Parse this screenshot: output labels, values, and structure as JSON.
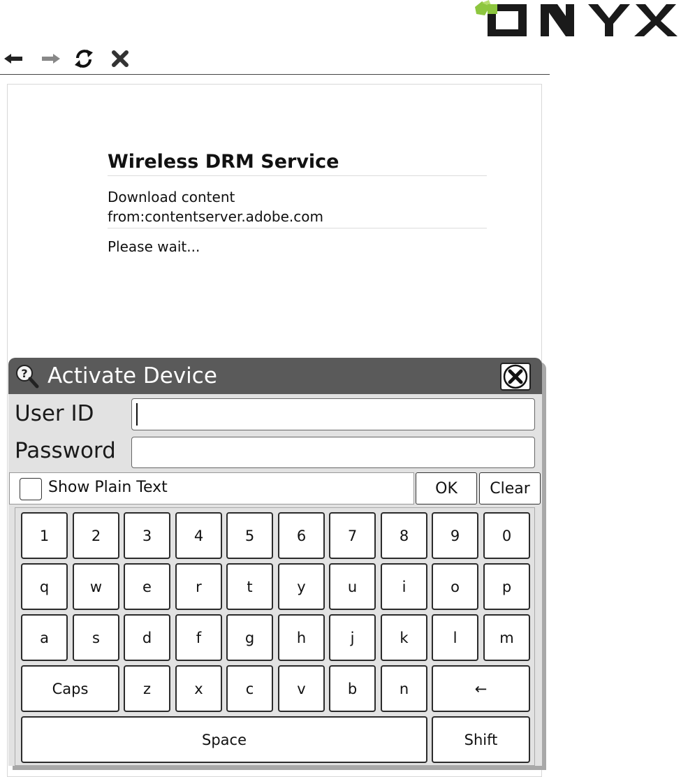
{
  "brand": {
    "logo_text": "ONYX",
    "logo_accent": "#8dc63f"
  },
  "toolbar": [
    {
      "name": "back-arrow-icon"
    },
    {
      "name": "forward-arrow-icon"
    },
    {
      "name": "refresh-icon"
    },
    {
      "name": "stop-icon"
    }
  ],
  "page": {
    "title": "Wireless DRM Service",
    "line1": "Download content",
    "line2": "from:contentserver.adobe.com",
    "status": "Please wait..."
  },
  "dialog": {
    "title": "Activate Device",
    "user_label": "User ID",
    "user_value": "",
    "password_label": "Password",
    "password_value": "",
    "show_plain_label": "Show Plain Text",
    "show_plain_checked": false,
    "ok_label": "OK",
    "clear_label": "Clear"
  },
  "keyboard": {
    "row1": [
      "1",
      "2",
      "3",
      "4",
      "5",
      "6",
      "7",
      "8",
      "9",
      "0"
    ],
    "row2": [
      "q",
      "w",
      "e",
      "r",
      "t",
      "y",
      "u",
      "i",
      "o",
      "p"
    ],
    "row3": [
      "a",
      "s",
      "d",
      "f",
      "g",
      "h",
      "j",
      "k",
      "l",
      "m"
    ],
    "row4": [
      "z",
      "x",
      "c",
      "v",
      "b",
      "n"
    ],
    "caps": "Caps",
    "backspace": "←",
    "space": "Space",
    "shift": "Shift"
  }
}
